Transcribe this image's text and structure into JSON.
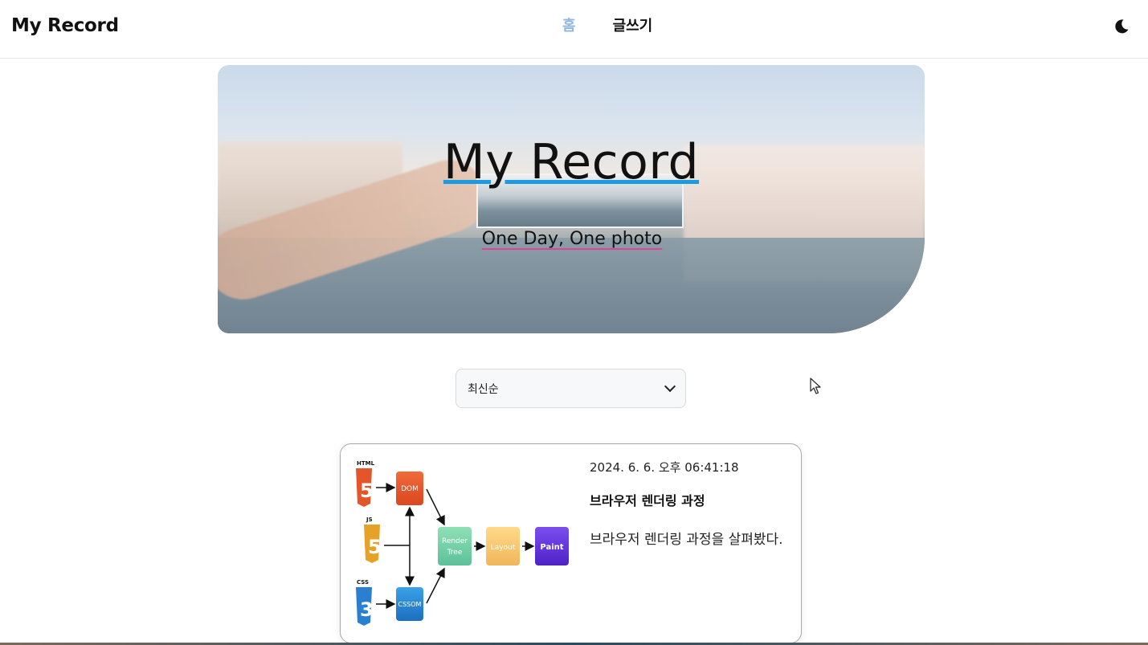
{
  "header": {
    "brand": "My Record",
    "nav": [
      {
        "label": "홈",
        "active": true
      },
      {
        "label": "글쓰기",
        "active": false
      }
    ],
    "theme_icon": "moon-icon"
  },
  "hero": {
    "title": "My Record",
    "subtitle": "One Day, One photo"
  },
  "sort": {
    "selected": "최신순"
  },
  "posts": [
    {
      "date": "2024. 6. 6. 오후 06:41:18",
      "title": "브라우저 렌더링 과정",
      "description": "브라우저 렌더링 과정을 살펴봤다.",
      "diagram": {
        "labels": {
          "html": "HTML",
          "js": "JS",
          "css": "CSS",
          "dom": "DOM",
          "cssom": "CSSOM",
          "render_tree_1": "Render",
          "render_tree_2": "Tree",
          "layout": "Layout",
          "paint": "Paint",
          "html_badge": "5",
          "js_badge": "5",
          "css_badge": "3"
        }
      }
    }
  ],
  "colors": {
    "accent_nav": "#8fb7de",
    "title_underline": "#1e9be0",
    "subtitle_underline": "#e0449a"
  }
}
